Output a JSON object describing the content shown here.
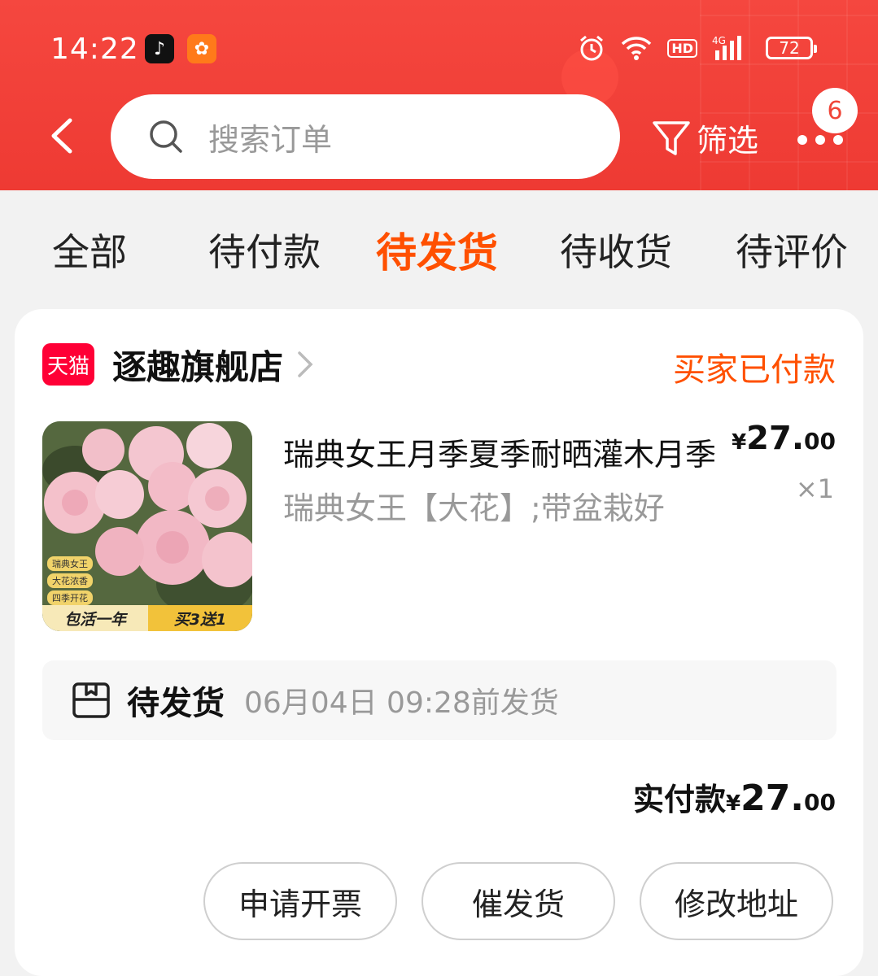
{
  "status_bar": {
    "time": "14:22",
    "battery": "72",
    "hd": "HD",
    "network": "4G"
  },
  "header": {
    "search_placeholder": "搜索订单",
    "filter_label": "筛选",
    "more_badge": "6",
    "brand_color": "#ee3a33"
  },
  "tabs": [
    {
      "label": "全部",
      "active": false
    },
    {
      "label": "待付款",
      "active": false
    },
    {
      "label": "待发货",
      "active": true
    },
    {
      "label": "待收货",
      "active": false
    },
    {
      "label": "待评价",
      "active": false
    }
  ],
  "order": {
    "shop_badge": "天猫",
    "shop_name": "逐趣旗舰店",
    "status": "买家已付款",
    "product": {
      "title": "瑞典女王月季夏季耐晒灌木月季",
      "spec": "瑞典女王【大花】;带盆栽好",
      "price_symbol": "¥",
      "price_int": "27.",
      "price_dec": "00",
      "quantity": "×1",
      "image_tags": [
        "瑞典女王",
        "大花浓香",
        "四季开花"
      ],
      "image_banner_left": "包活一年",
      "image_banner_right": "买3送1"
    },
    "shipping": {
      "label": "待发货",
      "deadline": "06月04日 09:28前发货"
    },
    "total": {
      "label": "实付款",
      "symbol": "¥",
      "int": "27.",
      "dec": "00"
    },
    "actions": [
      "申请开票",
      "催发货",
      "修改地址"
    ]
  }
}
